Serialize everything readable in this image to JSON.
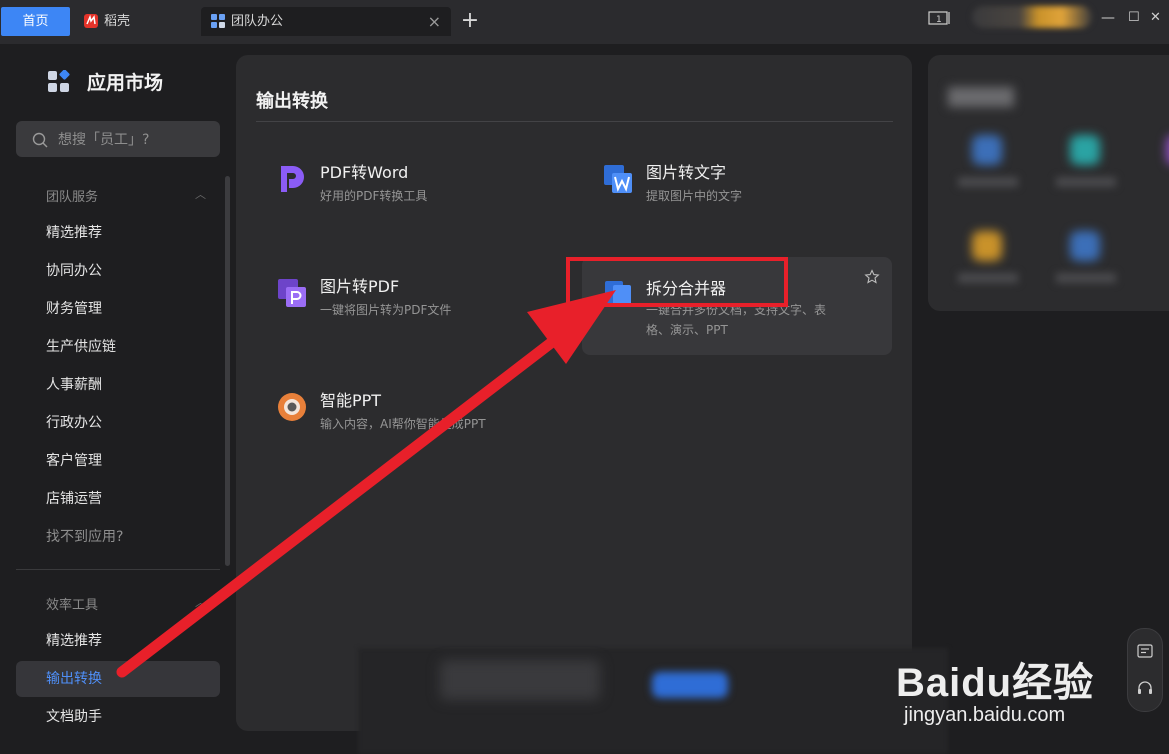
{
  "titlebar": {
    "tabs": [
      {
        "label": "首页",
        "active": true
      },
      {
        "label": "稻壳",
        "icon": "daoke-logo-icon"
      },
      {
        "label": "团队办公",
        "icon": "apps-grid-icon",
        "close": "×"
      }
    ],
    "add_tab": "+",
    "window_controls": {
      "minimize": "—",
      "maximize": "☐",
      "close": "✕"
    },
    "layout_badge": "1"
  },
  "sidebar": {
    "title": "应用市场",
    "search": {
      "placeholder": "想搜「员工」?"
    },
    "section1": {
      "heading": "团队服务",
      "items": [
        {
          "label": "精选推荐"
        },
        {
          "label": "协同办公"
        },
        {
          "label": "财务管理"
        },
        {
          "label": "生产供应链"
        },
        {
          "label": "人事薪酬"
        },
        {
          "label": "行政办公"
        },
        {
          "label": "客户管理"
        },
        {
          "label": "店铺运营"
        },
        {
          "label": "找不到应用?"
        }
      ]
    },
    "section2": {
      "heading": "效率工具",
      "items": [
        {
          "label": "精选推荐"
        },
        {
          "label": "输出转换",
          "active": true
        },
        {
          "label": "文档助手"
        }
      ]
    }
  },
  "main": {
    "title": "输出转换",
    "apps": [
      {
        "name": "PDF转Word",
        "desc": "好用的PDF转换工具",
        "icon": "pdf-to-word-icon"
      },
      {
        "name": "图片转文字",
        "desc": "提取图片中的文字",
        "icon": "image-to-text-icon"
      },
      {
        "name": "图片转PDF",
        "desc": "一键将图片转为PDF文件",
        "icon": "image-to-pdf-icon"
      },
      {
        "name": "拆分合并器",
        "desc": "一键合并多份文档，支持文字、表格、演示、PPT",
        "icon": "split-merge-icon"
      },
      {
        "name": "智能PPT",
        "desc": "输入内容，AI帮你智能生成PPT",
        "icon": "smart-ppt-icon"
      }
    ]
  },
  "watermark": {
    "logo": "Baidu经验",
    "url": "jingyan.baidu.com"
  },
  "colors": {
    "accent": "#3d86f5",
    "annotation": "#e8202a",
    "panel": "#2c2c2e",
    "background": "#1e1e20"
  }
}
